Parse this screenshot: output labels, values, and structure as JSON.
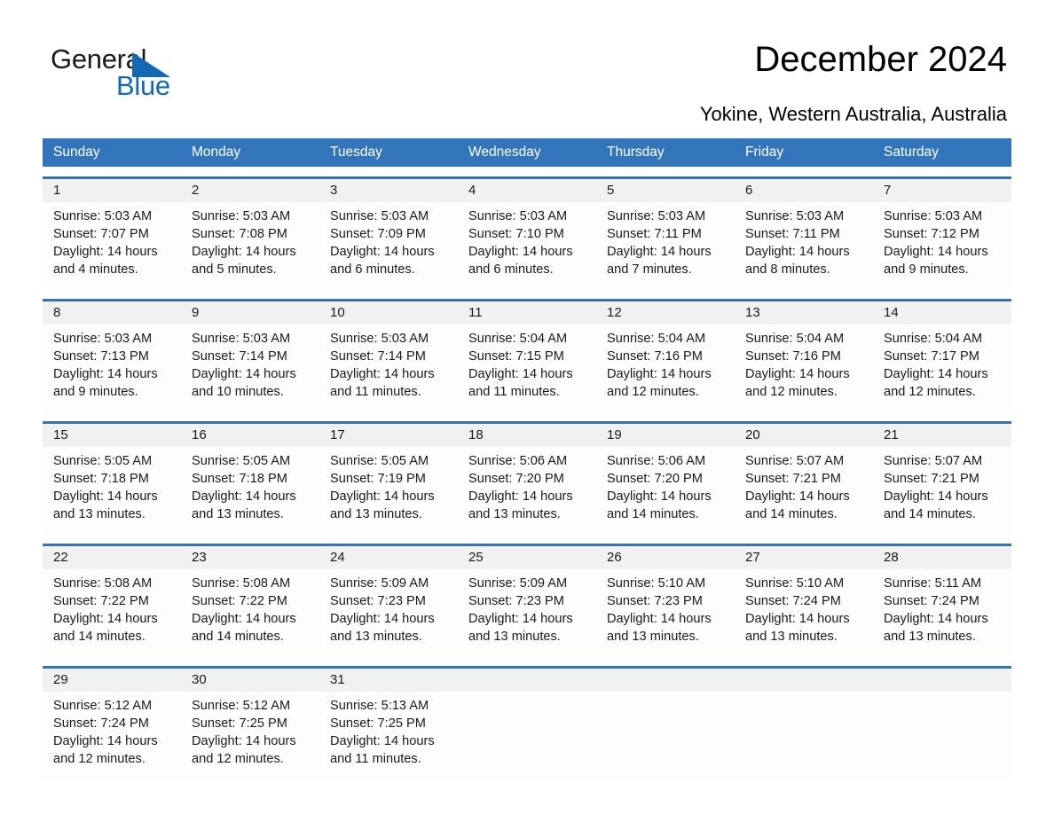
{
  "brand": {
    "name_part1": "General",
    "name_part2": "Blue",
    "triangle_color": "#1268b3",
    "text_color": "#1a1a1a"
  },
  "header": {
    "title": "December 2024",
    "subtitle": "Yokine, Western Australia, Australia"
  },
  "theme": {
    "header_blue": "#3275bb",
    "date_band_gray": "#f1f1f1",
    "cell_background": "#fdfdfd",
    "text_color": "#1a1a1a"
  },
  "calendar": {
    "weekday_headers": [
      "Sunday",
      "Monday",
      "Tuesday",
      "Wednesday",
      "Thursday",
      "Friday",
      "Saturday"
    ],
    "weeks": [
      {
        "days": [
          {
            "date": "1",
            "sunrise": "Sunrise: 5:03 AM",
            "sunset": "Sunset: 7:07 PM",
            "daylight_line1": "Daylight: 14 hours",
            "daylight_line2": "and 4 minutes."
          },
          {
            "date": "2",
            "sunrise": "Sunrise: 5:03 AM",
            "sunset": "Sunset: 7:08 PM",
            "daylight_line1": "Daylight: 14 hours",
            "daylight_line2": "and 5 minutes."
          },
          {
            "date": "3",
            "sunrise": "Sunrise: 5:03 AM",
            "sunset": "Sunset: 7:09 PM",
            "daylight_line1": "Daylight: 14 hours",
            "daylight_line2": "and 6 minutes."
          },
          {
            "date": "4",
            "sunrise": "Sunrise: 5:03 AM",
            "sunset": "Sunset: 7:10 PM",
            "daylight_line1": "Daylight: 14 hours",
            "daylight_line2": "and 6 minutes."
          },
          {
            "date": "5",
            "sunrise": "Sunrise: 5:03 AM",
            "sunset": "Sunset: 7:11 PM",
            "daylight_line1": "Daylight: 14 hours",
            "daylight_line2": "and 7 minutes."
          },
          {
            "date": "6",
            "sunrise": "Sunrise: 5:03 AM",
            "sunset": "Sunset: 7:11 PM",
            "daylight_line1": "Daylight: 14 hours",
            "daylight_line2": "and 8 minutes."
          },
          {
            "date": "7",
            "sunrise": "Sunrise: 5:03 AM",
            "sunset": "Sunset: 7:12 PM",
            "daylight_line1": "Daylight: 14 hours",
            "daylight_line2": "and 9 minutes."
          }
        ]
      },
      {
        "days": [
          {
            "date": "8",
            "sunrise": "Sunrise: 5:03 AM",
            "sunset": "Sunset: 7:13 PM",
            "daylight_line1": "Daylight: 14 hours",
            "daylight_line2": "and 9 minutes."
          },
          {
            "date": "9",
            "sunrise": "Sunrise: 5:03 AM",
            "sunset": "Sunset: 7:14 PM",
            "daylight_line1": "Daylight: 14 hours",
            "daylight_line2": "and 10 minutes."
          },
          {
            "date": "10",
            "sunrise": "Sunrise: 5:03 AM",
            "sunset": "Sunset: 7:14 PM",
            "daylight_line1": "Daylight: 14 hours",
            "daylight_line2": "and 11 minutes."
          },
          {
            "date": "11",
            "sunrise": "Sunrise: 5:04 AM",
            "sunset": "Sunset: 7:15 PM",
            "daylight_line1": "Daylight: 14 hours",
            "daylight_line2": "and 11 minutes."
          },
          {
            "date": "12",
            "sunrise": "Sunrise: 5:04 AM",
            "sunset": "Sunset: 7:16 PM",
            "daylight_line1": "Daylight: 14 hours",
            "daylight_line2": "and 12 minutes."
          },
          {
            "date": "13",
            "sunrise": "Sunrise: 5:04 AM",
            "sunset": "Sunset: 7:16 PM",
            "daylight_line1": "Daylight: 14 hours",
            "daylight_line2": "and 12 minutes."
          },
          {
            "date": "14",
            "sunrise": "Sunrise: 5:04 AM",
            "sunset": "Sunset: 7:17 PM",
            "daylight_line1": "Daylight: 14 hours",
            "daylight_line2": "and 12 minutes."
          }
        ]
      },
      {
        "days": [
          {
            "date": "15",
            "sunrise": "Sunrise: 5:05 AM",
            "sunset": "Sunset: 7:18 PM",
            "daylight_line1": "Daylight: 14 hours",
            "daylight_line2": "and 13 minutes."
          },
          {
            "date": "16",
            "sunrise": "Sunrise: 5:05 AM",
            "sunset": "Sunset: 7:18 PM",
            "daylight_line1": "Daylight: 14 hours",
            "daylight_line2": "and 13 minutes."
          },
          {
            "date": "17",
            "sunrise": "Sunrise: 5:05 AM",
            "sunset": "Sunset: 7:19 PM",
            "daylight_line1": "Daylight: 14 hours",
            "daylight_line2": "and 13 minutes."
          },
          {
            "date": "18",
            "sunrise": "Sunrise: 5:06 AM",
            "sunset": "Sunset: 7:20 PM",
            "daylight_line1": "Daylight: 14 hours",
            "daylight_line2": "and 13 minutes."
          },
          {
            "date": "19",
            "sunrise": "Sunrise: 5:06 AM",
            "sunset": "Sunset: 7:20 PM",
            "daylight_line1": "Daylight: 14 hours",
            "daylight_line2": "and 14 minutes."
          },
          {
            "date": "20",
            "sunrise": "Sunrise: 5:07 AM",
            "sunset": "Sunset: 7:21 PM",
            "daylight_line1": "Daylight: 14 hours",
            "daylight_line2": "and 14 minutes."
          },
          {
            "date": "21",
            "sunrise": "Sunrise: 5:07 AM",
            "sunset": "Sunset: 7:21 PM",
            "daylight_line1": "Daylight: 14 hours",
            "daylight_line2": "and 14 minutes."
          }
        ]
      },
      {
        "days": [
          {
            "date": "22",
            "sunrise": "Sunrise: 5:08 AM",
            "sunset": "Sunset: 7:22 PM",
            "daylight_line1": "Daylight: 14 hours",
            "daylight_line2": "and 14 minutes."
          },
          {
            "date": "23",
            "sunrise": "Sunrise: 5:08 AM",
            "sunset": "Sunset: 7:22 PM",
            "daylight_line1": "Daylight: 14 hours",
            "daylight_line2": "and 14 minutes."
          },
          {
            "date": "24",
            "sunrise": "Sunrise: 5:09 AM",
            "sunset": "Sunset: 7:23 PM",
            "daylight_line1": "Daylight: 14 hours",
            "daylight_line2": "and 13 minutes."
          },
          {
            "date": "25",
            "sunrise": "Sunrise: 5:09 AM",
            "sunset": "Sunset: 7:23 PM",
            "daylight_line1": "Daylight: 14 hours",
            "daylight_line2": "and 13 minutes."
          },
          {
            "date": "26",
            "sunrise": "Sunrise: 5:10 AM",
            "sunset": "Sunset: 7:23 PM",
            "daylight_line1": "Daylight: 14 hours",
            "daylight_line2": "and 13 minutes."
          },
          {
            "date": "27",
            "sunrise": "Sunrise: 5:10 AM",
            "sunset": "Sunset: 7:24 PM",
            "daylight_line1": "Daylight: 14 hours",
            "daylight_line2": "and 13 minutes."
          },
          {
            "date": "28",
            "sunrise": "Sunrise: 5:11 AM",
            "sunset": "Sunset: 7:24 PM",
            "daylight_line1": "Daylight: 14 hours",
            "daylight_line2": "and 13 minutes."
          }
        ]
      },
      {
        "days": [
          {
            "date": "29",
            "sunrise": "Sunrise: 5:12 AM",
            "sunset": "Sunset: 7:24 PM",
            "daylight_line1": "Daylight: 14 hours",
            "daylight_line2": "and 12 minutes."
          },
          {
            "date": "30",
            "sunrise": "Sunrise: 5:12 AM",
            "sunset": "Sunset: 7:25 PM",
            "daylight_line1": "Daylight: 14 hours",
            "daylight_line2": "and 12 minutes."
          },
          {
            "date": "31",
            "sunrise": "Sunrise: 5:13 AM",
            "sunset": "Sunset: 7:25 PM",
            "daylight_line1": "Daylight: 14 hours",
            "daylight_line2": "and 11 minutes."
          },
          {
            "date": "",
            "sunrise": "",
            "sunset": "",
            "daylight_line1": "",
            "daylight_line2": ""
          },
          {
            "date": "",
            "sunrise": "",
            "sunset": "",
            "daylight_line1": "",
            "daylight_line2": ""
          },
          {
            "date": "",
            "sunrise": "",
            "sunset": "",
            "daylight_line1": "",
            "daylight_line2": ""
          },
          {
            "date": "",
            "sunrise": "",
            "sunset": "",
            "daylight_line1": "",
            "daylight_line2": ""
          }
        ]
      }
    ]
  }
}
